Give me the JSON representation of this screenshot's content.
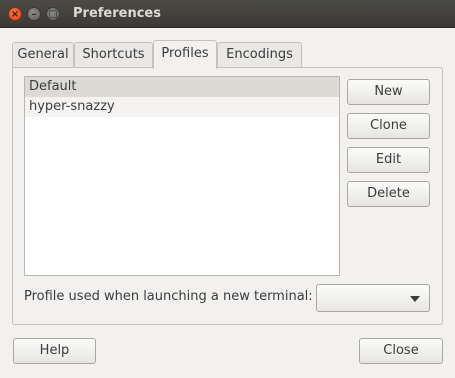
{
  "window": {
    "title": "Preferences",
    "close_glyph": "×",
    "min_glyph": "–",
    "max_glyph": "□"
  },
  "tabs": [
    {
      "label": "General",
      "active": false
    },
    {
      "label": "Shortcuts",
      "active": false
    },
    {
      "label": "Profiles",
      "active": true
    },
    {
      "label": "Encodings",
      "active": false
    }
  ],
  "profiles": {
    "items": [
      {
        "label": "Default",
        "selected": true
      },
      {
        "label": "hyper-snazzy",
        "selected": false
      }
    ],
    "buttons": {
      "new": "New",
      "clone": "Clone",
      "edit": "Edit",
      "delete": "Delete"
    },
    "launch_label": "Profile used when launching a new terminal:",
    "launch_selected": ""
  },
  "footer": {
    "help": "Help",
    "close": "Close"
  }
}
